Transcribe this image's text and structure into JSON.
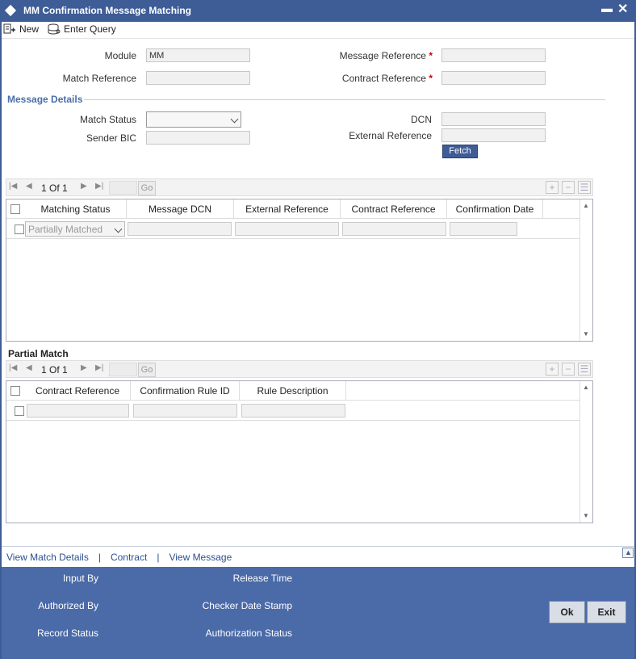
{
  "window": {
    "title": "MM Confirmation Message Matching"
  },
  "toolbar": {
    "new_label": "New",
    "enter_query_label": "Enter Query"
  },
  "form": {
    "module_label": "Module",
    "module_value": "MM",
    "message_reference_label": "Message Reference",
    "match_reference_label": "Match Reference",
    "contract_reference_label": "Contract Reference",
    "required_mark": "*"
  },
  "message_details": {
    "section_title": "Message Details",
    "match_status_label": "Match Status",
    "match_status_value": "",
    "sender_bic_label": "Sender BIC",
    "dcn_label": "DCN",
    "external_reference_label": "External Reference",
    "fetch_label": "Fetch"
  },
  "grid1": {
    "page_current": "1",
    "page_of": "Of",
    "page_total": "1",
    "go_label": "Go",
    "columns": [
      "Matching Status",
      "Message DCN",
      "External Reference",
      "Contract Reference",
      "Confirmation Date"
    ],
    "row_matching_status": "Partially Matched"
  },
  "partial_match": {
    "section_title": "Partial Match",
    "page_current": "1",
    "page_of": "Of",
    "page_total": "1",
    "go_label": "Go",
    "columns": [
      "Contract Reference",
      "Confirmation Rule ID",
      "Rule Description"
    ]
  },
  "links": {
    "view_match_details": "View Match Details",
    "separator": "|",
    "contract": "Contract",
    "view_message": "View Message"
  },
  "footer": {
    "input_by": "Input By",
    "authorized_by": "Authorized By",
    "record_status": "Record Status",
    "release_time": "Release Time",
    "checker_date_stamp": "Checker Date Stamp",
    "authorization_status": "Authorization Status",
    "ok_label": "Ok",
    "exit_label": "Exit"
  }
}
